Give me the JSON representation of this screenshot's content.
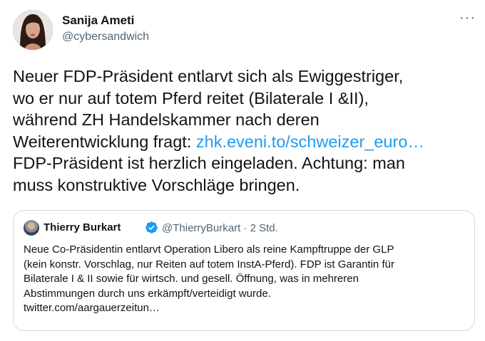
{
  "tweet": {
    "author_name": "Sanija Ameti",
    "author_handle": "@cybersandwich",
    "more_label": "···",
    "text_lines": [
      "Neuer FDP-Präsident entlarvt sich als Ewiggestriger,",
      "wo er nur auf totem Pferd reitet (Bilaterale I &II),",
      "während ZH Handelskammer nach deren",
      "Weiterentwicklung fragt: "
    ],
    "link_text": "zhk.eveni.to/schweizer_euro…",
    "text_lines_after": [
      "FDP-Präsident ist herzlich eingeladen. Achtung: man",
      "muss konstruktive Vorschläge bringen."
    ]
  },
  "quote": {
    "author_name": "Thierry Burkart",
    "author_handle_time": "@ThierryBurkart · 2 Std.",
    "text_lines": [
      "Neue Co-Präsidentin entlarvt Operation Libero als reine Kampftruppe der GLP",
      "(kein konstr. Vorschlag, nur Reiten auf totem InstA-Pferd). FDP ist Garantin für",
      "Bilaterale I & II sowie für wirtsch. und gesell. Öffnung, was in mehreren",
      "Abstimmungen durch uns erkämpft/verteidigt wurde.",
      "twitter.com/aargauerzeitun…"
    ]
  },
  "colors": {
    "link": "#1d9bf0",
    "secondary_text": "#536471",
    "border": "#cfd9de",
    "verified": "#1d9bf0"
  },
  "icons": {
    "more": "more-horizontal-icon",
    "verified": "verified-badge-icon"
  }
}
